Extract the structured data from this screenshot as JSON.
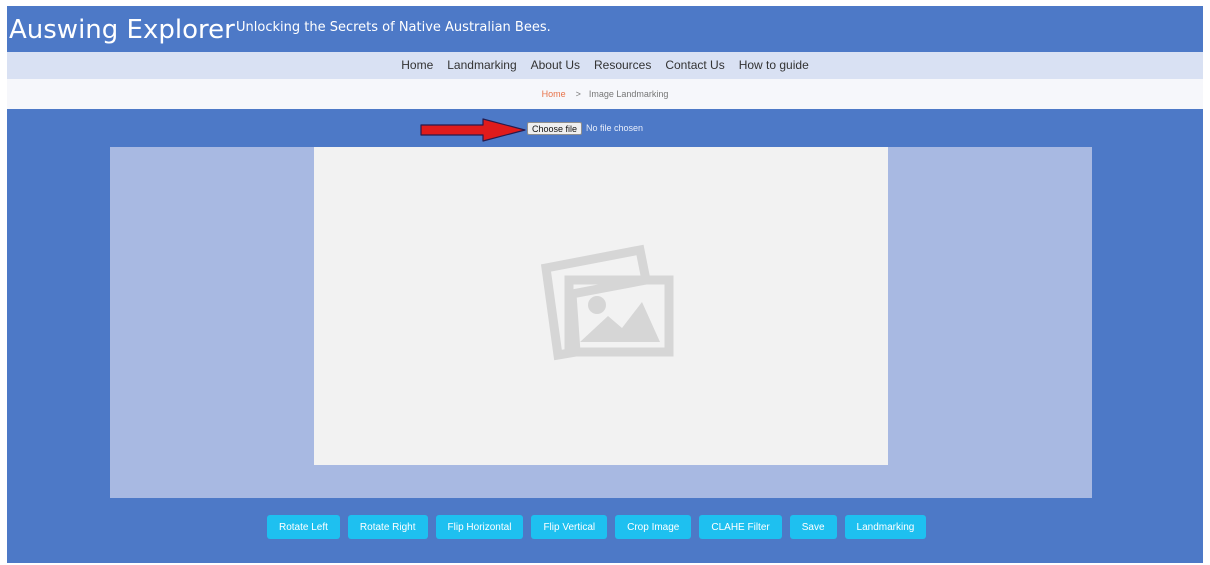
{
  "header": {
    "brand": "Auswing Explorer",
    "tagline": "Unlocking the Secrets of Native Australian Bees."
  },
  "nav": {
    "items": [
      {
        "label": "Home"
      },
      {
        "label": "Landmarking"
      },
      {
        "label": "About Us"
      },
      {
        "label": "Resources"
      },
      {
        "label": "Contact Us"
      },
      {
        "label": "How to guide"
      }
    ]
  },
  "breadcrumb": {
    "home": "Home",
    "separator": ">",
    "current": "Image Landmarking"
  },
  "upload": {
    "button_label": "Choose file",
    "status": "No file chosen"
  },
  "toolbar": {
    "buttons": [
      {
        "label": "Rotate Left"
      },
      {
        "label": "Rotate Right"
      },
      {
        "label": "Flip Horizontal"
      },
      {
        "label": "Flip Vertical"
      },
      {
        "label": "Crop Image"
      },
      {
        "label": "CLAHE Filter"
      },
      {
        "label": "Save"
      },
      {
        "label": "Landmarking"
      }
    ]
  },
  "colors": {
    "background": "#4d79c7",
    "nav": "#d9e1f3",
    "stage": "#a8b9e2",
    "canvas": "#f2f2f2",
    "button": "#1ec0f0",
    "arrow": "#e01b1b",
    "breadcrumb_home": "#e8734a"
  },
  "icons": {
    "placeholder": "image-placeholder-icon",
    "pointer": "arrow-right-icon"
  }
}
